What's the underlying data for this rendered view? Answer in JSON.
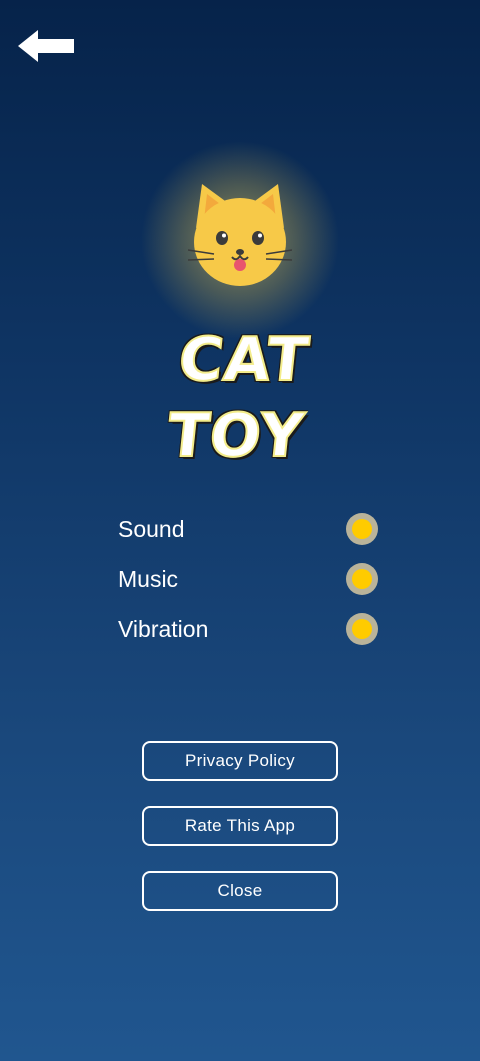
{
  "header": {
    "back_icon": "arrow-left-icon"
  },
  "app": {
    "title": "CAT TOY",
    "mascot_icon": "cat-face-icon"
  },
  "settings": [
    {
      "label": "Sound",
      "enabled": true
    },
    {
      "label": "Music",
      "enabled": true
    },
    {
      "label": "Vibration",
      "enabled": true
    }
  ],
  "buttons": {
    "privacy": "Privacy Policy",
    "rate": "Rate This App",
    "close": "Close"
  },
  "colors": {
    "background_top": "#06234a",
    "background_bottom": "#20568f",
    "toggle_on": "#ffcb00",
    "cat_face": "#f7c948"
  }
}
